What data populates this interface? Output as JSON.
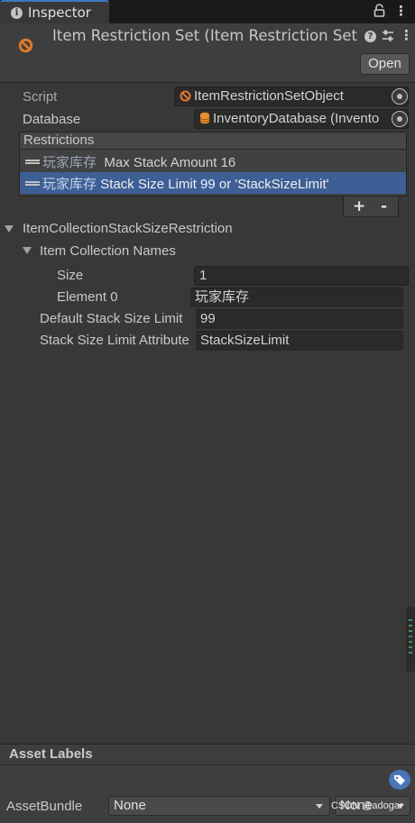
{
  "tab": {
    "title": "Inspector"
  },
  "header": {
    "title": "Item Restriction Set (Item Restriction Set O",
    "open_button": "Open"
  },
  "fields": {
    "script": {
      "label": "Script",
      "value": "ItemRestrictionSetObject"
    },
    "database": {
      "label": "Database",
      "value": "InventoryDatabase (Invento"
    }
  },
  "restrictions": {
    "label": "Restrictions",
    "items": [
      {
        "prefix": "玩家库存",
        "text": "Max Stack Amount 16",
        "selected": false
      },
      {
        "prefix": "玩家库存",
        "text": "Stack Size Limit 99 or 'StackSizeLimit'",
        "selected": true
      }
    ],
    "add": "+",
    "remove": "-"
  },
  "details": {
    "title": "ItemCollectionStackSizeRestriction",
    "names_foldout": "Item Collection Names",
    "size": {
      "label": "Size",
      "value": "1"
    },
    "element0": {
      "label": "Element 0",
      "value": "玩家库存"
    },
    "default_limit": {
      "label": "Default Stack Size Limit",
      "value": "99"
    },
    "limit_attribute": {
      "label": "Stack Size Limit Attribute",
      "value": "StackSizeLimit"
    }
  },
  "asset": {
    "labels_title": "Asset Labels",
    "bundle_label": "AssetBundle",
    "bundle_value": "None",
    "variant_value": "None"
  },
  "watermark": "CSDN @adogar",
  "colors": {
    "accent": "#3a79bb",
    "selection": "#3e5f96",
    "object_icon": "#e0792a",
    "db_icon": "#e8902a"
  }
}
